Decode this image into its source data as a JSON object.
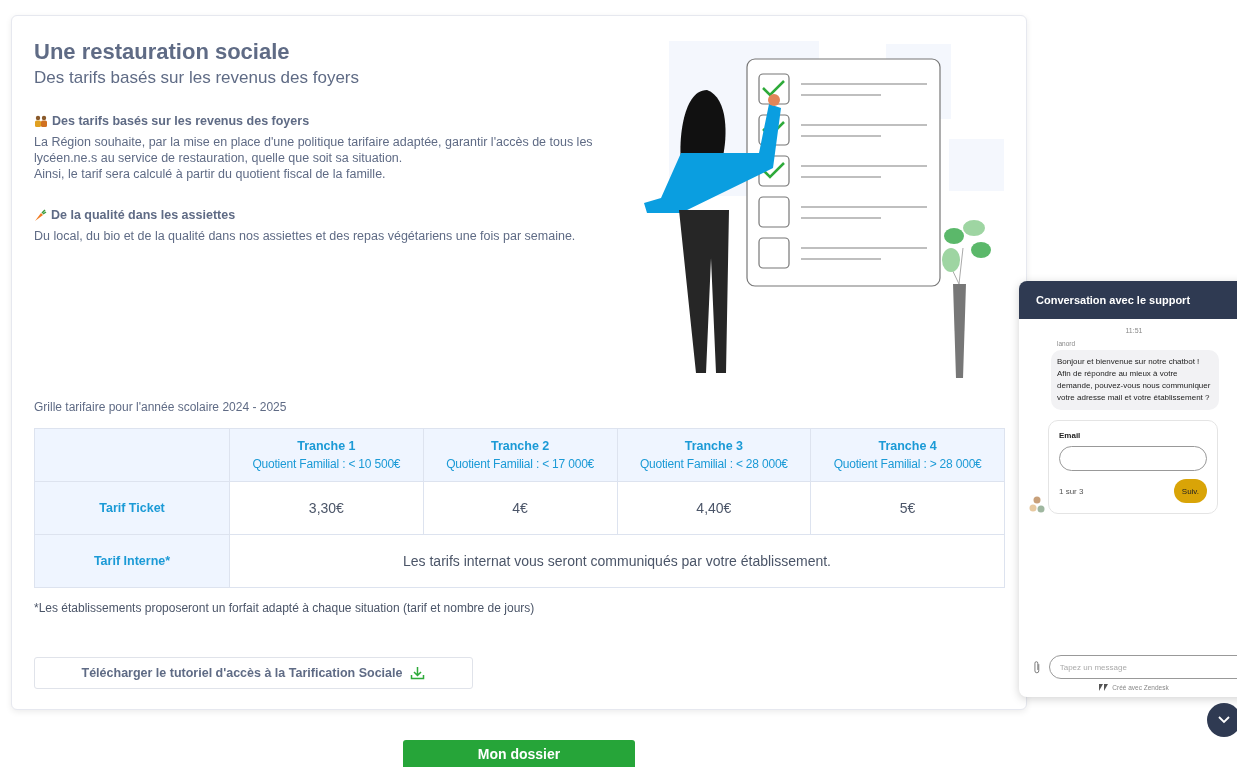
{
  "card": {
    "title": "Une restauration sociale",
    "subtitle": "Des tarifs basés sur les revenus des foyers",
    "sections": [
      {
        "kind": "family",
        "heading": "Des tarifs basés sur les revenus des foyers",
        "paragraphs": [
          "La Région souhaite, par la mise en place d'une politique tarifaire adaptée, garantir l'accès de tous les lycéen.ne.s au service de restauration, quelle que soit sa situation.",
          "Ainsi, le tarif sera calculé à partir du quotient fiscal de la famille."
        ]
      },
      {
        "kind": "carrot",
        "heading": "De la qualité dans les assiettes",
        "paragraphs": [
          "Du local, du bio et de la qualité dans nos assiettes et des repas végétariens une fois par semaine."
        ]
      }
    ],
    "table_caption": "Grille tarifaire pour l'année scolaire 2024 - 2025",
    "table": {
      "columns": [
        {
          "title": "Tranche 1",
          "subtitle": "Quotient Familial : < 10 500€"
        },
        {
          "title": "Tranche 2",
          "subtitle": "Quotient Familial : < 17 000€"
        },
        {
          "title": "Tranche 3",
          "subtitle": "Quotient Familial : < 28 000€"
        },
        {
          "title": "Tranche 4",
          "subtitle": "Quotient Familial : > 28 000€"
        }
      ],
      "rows": [
        {
          "kind": "values",
          "label": "Tarif Ticket",
          "cells": [
            "3,30€",
            "4€",
            "4,40€",
            "5€"
          ]
        },
        {
          "kind": "merged",
          "label": "Tarif Interne*",
          "cells": [
            {
              "text": "Les tarifs internat vous seront communiqués par votre établissement.",
              "colspan": 4
            }
          ]
        }
      ]
    },
    "footnote": "*Les établissements proposeront un forfait adapté à chaque situation (tarif et nombre de jours)",
    "download_button": "Télécharger le tutoriel d'accès à la Tarification Sociale"
  },
  "primary_button": "Mon dossier",
  "chat": {
    "title": "Conversation avec le support",
    "time": "11:51",
    "sender": "lanord",
    "message": [
      "Bonjour et bienvenue sur notre chatbot !",
      "Afin de répondre au mieux à votre demande, pouvez-vous nous communiquer votre adresse mail et votre établissement ?"
    ],
    "form": {
      "label": "Email",
      "step": "1 sur 3",
      "next_button": "Suiv."
    },
    "input": {
      "placeholder": "Tapez un message"
    },
    "footer": "Créé avec Zendesk"
  }
}
